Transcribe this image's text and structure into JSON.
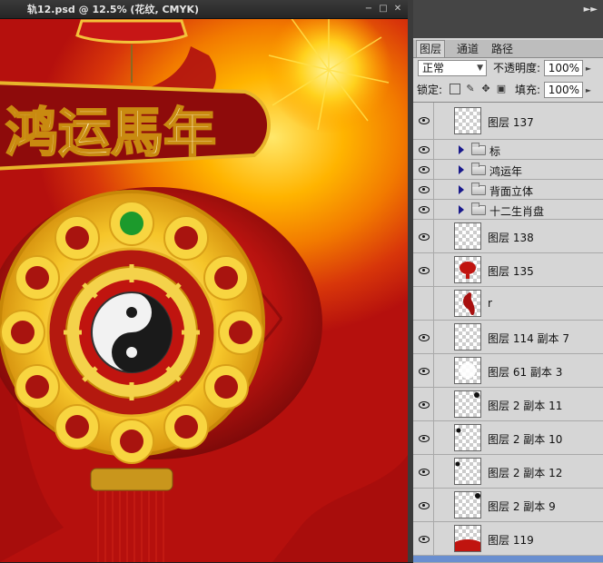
{
  "document": {
    "title": "轨12.psd @ 12.5% (花纹, CMYK)",
    "artwork_heading": "鸿运馬年",
    "window_buttons": [
      "minimize-icon",
      "restore-icon",
      "close-icon"
    ]
  },
  "panel": {
    "tabs": [
      "图层",
      "通道",
      "路径"
    ],
    "blend_mode": "正常",
    "opacity_label": "不透明度:",
    "opacity_value": "100%",
    "lock_label": "锁定:",
    "fill_label": "填充:",
    "fill_value": "100%"
  },
  "layers": [
    {
      "name": "图层 137",
      "type": "layer",
      "visible": true,
      "thumb": "blank"
    },
    {
      "name": "标",
      "type": "group",
      "visible": true
    },
    {
      "name": "鸿运年",
      "type": "group",
      "visible": true
    },
    {
      "name": "背面立体",
      "type": "group",
      "visible": true
    },
    {
      "name": "十二生肖盘",
      "type": "group",
      "visible": true
    },
    {
      "name": "图层 138",
      "type": "layer",
      "visible": true,
      "thumb": "faint"
    },
    {
      "name": "图层 135",
      "type": "layer",
      "visible": true,
      "thumb": "lantern"
    },
    {
      "name": "r",
      "type": "layer",
      "visible": false,
      "thumb": "ribbon"
    },
    {
      "name": "图层 114 副本 7",
      "type": "layer",
      "visible": true,
      "thumb": "blank"
    },
    {
      "name": "图层 61 副本 3",
      "type": "layer",
      "visible": true,
      "thumb": "glow"
    },
    {
      "name": "图层 2 副本 11",
      "type": "layer",
      "visible": true,
      "thumb": "dot-tr"
    },
    {
      "name": "图层 2 副本 10",
      "type": "layer",
      "visible": true,
      "thumb": "dot-tl"
    },
    {
      "name": "图层 2 副本 12",
      "type": "layer",
      "visible": true,
      "thumb": "dot-l"
    },
    {
      "name": "图层 2 副本 9",
      "type": "layer",
      "visible": true,
      "thumb": "dot-tr"
    },
    {
      "name": "图层 119",
      "type": "layer",
      "visible": true,
      "thumb": "red-bottom"
    }
  ]
}
